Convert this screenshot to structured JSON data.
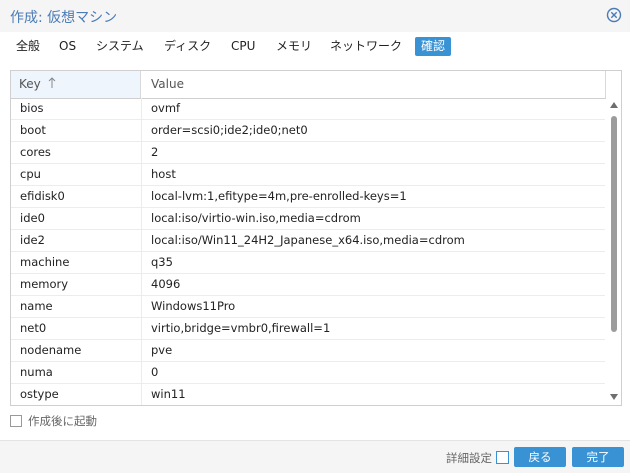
{
  "window": {
    "title": "作成: 仮想マシン",
    "close_icon": "close-circle-icon",
    "accent_color": "#3892d4"
  },
  "tabs": [
    {
      "label": "全般",
      "active": false
    },
    {
      "label": "OS",
      "active": false
    },
    {
      "label": "システム",
      "active": false
    },
    {
      "label": "ディスク",
      "active": false
    },
    {
      "label": "CPU",
      "active": false
    },
    {
      "label": "メモリ",
      "active": false
    },
    {
      "label": "ネットワーク",
      "active": false
    },
    {
      "label": "確認",
      "active": true
    }
  ],
  "grid": {
    "columns": {
      "key": "Key",
      "value": "Value"
    },
    "sort_icon": "arrow-up-icon",
    "rows": [
      {
        "key": "bios",
        "value": "ovmf"
      },
      {
        "key": "boot",
        "value": "order=scsi0;ide2;ide0;net0"
      },
      {
        "key": "cores",
        "value": "2"
      },
      {
        "key": "cpu",
        "value": "host"
      },
      {
        "key": "efidisk0",
        "value": "local-lvm:1,efitype=4m,pre-enrolled-keys=1"
      },
      {
        "key": "ide0",
        "value": "local:iso/virtio-win.iso,media=cdrom"
      },
      {
        "key": "ide2",
        "value": "local:iso/Win11_24H2_Japanese_x64.iso,media=cdrom"
      },
      {
        "key": "machine",
        "value": "q35"
      },
      {
        "key": "memory",
        "value": "4096"
      },
      {
        "key": "name",
        "value": "Windows11Pro"
      },
      {
        "key": "net0",
        "value": "virtio,bridge=vmbr0,firewall=1"
      },
      {
        "key": "nodename",
        "value": "pve"
      },
      {
        "key": "numa",
        "value": "0"
      },
      {
        "key": "ostype",
        "value": "win11"
      }
    ]
  },
  "start_after_create": {
    "label": "作成後に起動",
    "checked": false
  },
  "footer": {
    "advanced_label": "詳細設定",
    "advanced_checked": false,
    "back_label": "戻る",
    "finish_label": "完了"
  }
}
